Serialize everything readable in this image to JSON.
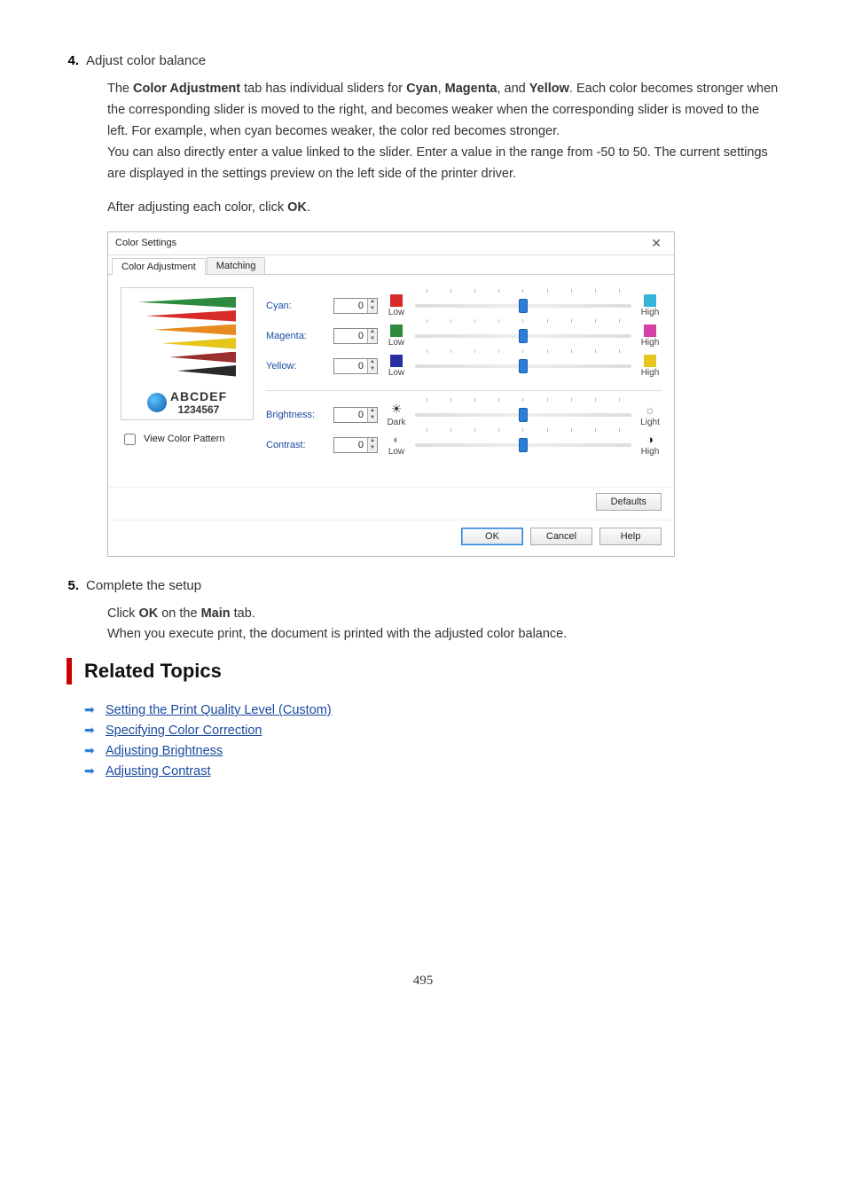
{
  "step4": {
    "num": "4.",
    "title": "Adjust color balance",
    "p1_pre": "The ",
    "p1_b1": "Color Adjustment",
    "p1_mid1": " tab has individual sliders for ",
    "p1_b2": "Cyan",
    "p1_mid2": ", ",
    "p1_b3": "Magenta",
    "p1_mid3": ", and ",
    "p1_b4": "Yellow",
    "p1_post": ". Each color becomes stronger when the corresponding slider is moved to the right, and becomes weaker when the corresponding slider is moved to the left. For example, when cyan becomes weaker, the color red becomes stronger.",
    "p2": "You can also directly enter a value linked to the slider. Enter a value in the range from -50 to 50. The current settings are displayed in the settings preview on the left side of the printer driver.",
    "p3_pre": "After adjusting each color, click ",
    "p3_b": "OK",
    "p3_post": "."
  },
  "dialog": {
    "title": "Color Settings",
    "tab1": "Color Adjustment",
    "tab2": "Matching",
    "preview_text": "ABCDEF",
    "preview_num": "1234567",
    "view_pattern": "View Color Pattern",
    "rows": {
      "cyan": {
        "label": "Cyan:",
        "val": "0",
        "low": "Low",
        "high": "High"
      },
      "magenta": {
        "label": "Magenta:",
        "val": "0",
        "low": "Low",
        "high": "High"
      },
      "yellow": {
        "label": "Yellow:",
        "val": "0",
        "low": "Low",
        "high": "High"
      },
      "bright": {
        "label": "Brightness:",
        "val": "0",
        "low": "Dark",
        "high": "Light"
      },
      "contrast": {
        "label": "Contrast:",
        "val": "0",
        "low": "Low",
        "high": "High"
      }
    },
    "defaults": "Defaults",
    "ok": "OK",
    "cancel": "Cancel",
    "help": "Help"
  },
  "step5": {
    "num": "5.",
    "title": "Complete the setup",
    "line1_pre": "Click ",
    "line1_b1": "OK",
    "line1_mid": " on the ",
    "line1_b2": "Main",
    "line1_post": " tab.",
    "line2": "When you execute print, the document is printed with the adjusted color balance."
  },
  "related": {
    "heading": "Related Topics",
    "items": [
      "Setting the Print Quality Level (Custom)",
      "Specifying Color Correction",
      "Adjusting Brightness",
      "Adjusting Contrast"
    ]
  },
  "page_number": "495"
}
